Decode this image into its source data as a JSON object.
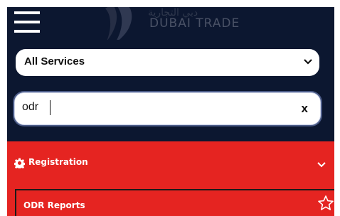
{
  "header": {
    "brand_ar": "دبي التجارية",
    "brand_en": "DUBAI TRADE"
  },
  "search": {
    "service_select": {
      "selected": "All Services",
      "icon": "chevron-down-icon"
    },
    "query": {
      "value": "odr",
      "clear_label": "x"
    }
  },
  "menu": {
    "section": {
      "label": "Registration",
      "icon": "gear-icon",
      "expand_icon": "chevron-down-icon"
    },
    "items": [
      {
        "label": "ODR Reports",
        "icon": "star-icon"
      }
    ]
  },
  "colors": {
    "header_bg": "#0c1730",
    "accent_red": "#e52421",
    "text_white": "#ffffff"
  }
}
